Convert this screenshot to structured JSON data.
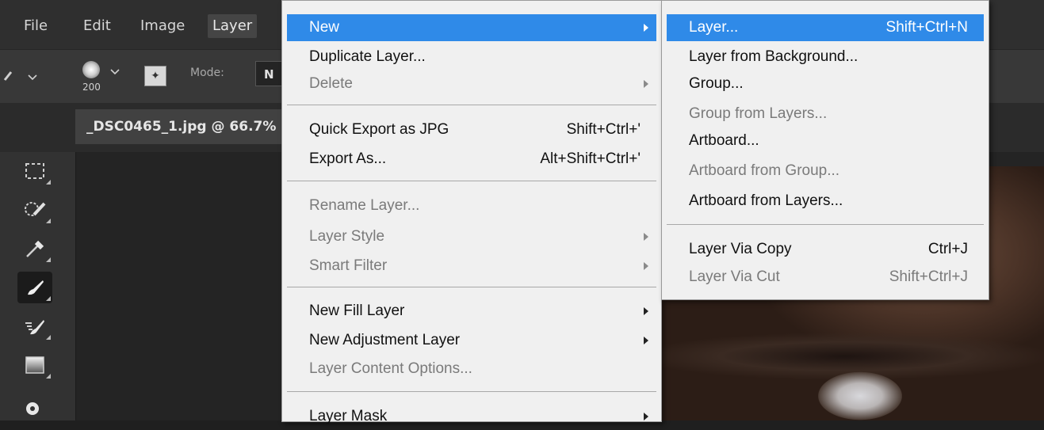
{
  "menubar": {
    "items": [
      "File",
      "Edit",
      "Image",
      "Layer"
    ]
  },
  "options_bar": {
    "brush_size": "200",
    "mode_label": "Mode:",
    "mode_value": "N"
  },
  "document_tab": {
    "title": "_DSC0465_1.jpg @ 66.7%"
  },
  "tools": [
    {
      "name": "marquee-tool",
      "icon": "marquee-icon",
      "active": false
    },
    {
      "name": "quick-selection-tool",
      "icon": "quick-selection-icon",
      "active": false
    },
    {
      "name": "eyedropper-tool",
      "icon": "eyedropper-icon",
      "active": false
    },
    {
      "name": "brush-tool",
      "icon": "brush-icon",
      "active": true
    },
    {
      "name": "history-brush-tool",
      "icon": "history-brush-icon",
      "active": false
    },
    {
      "name": "gradient-tool",
      "icon": "gradient-icon",
      "active": false
    },
    {
      "name": "dodge-tool",
      "icon": "dodge-icon",
      "active": false
    }
  ],
  "layer_menu": {
    "new": "New",
    "duplicate_layer": "Duplicate Layer...",
    "delete": "Delete",
    "quick_export": "Quick Export as JPG",
    "quick_export_shortcut": "Shift+Ctrl+'",
    "export_as": "Export As...",
    "export_as_shortcut": "Alt+Shift+Ctrl+'",
    "rename_layer": "Rename Layer...",
    "layer_style": "Layer Style",
    "smart_filter": "Smart Filter",
    "new_fill_layer": "New Fill Layer",
    "new_adjustment_layer": "New Adjustment Layer",
    "layer_content_options": "Layer Content Options...",
    "layer_mask": "Layer Mask"
  },
  "new_submenu": {
    "layer": "Layer...",
    "layer_shortcut": "Shift+Ctrl+N",
    "layer_from_background": "Layer from Background...",
    "group": "Group...",
    "group_from_layers": "Group from Layers...",
    "artboard": "Artboard...",
    "artboard_from_group": "Artboard from Group...",
    "artboard_from_layers": "Artboard from Layers...",
    "layer_via_copy": "Layer Via Copy",
    "layer_via_copy_shortcut": "Ctrl+J",
    "layer_via_cut": "Layer Via Cut",
    "layer_via_cut_shortcut": "Shift+Ctrl+J"
  },
  "colors": {
    "highlight": "#2f8ae8",
    "menu_bg": "#f0f0f0",
    "app_bg": "#2f2f2f"
  }
}
